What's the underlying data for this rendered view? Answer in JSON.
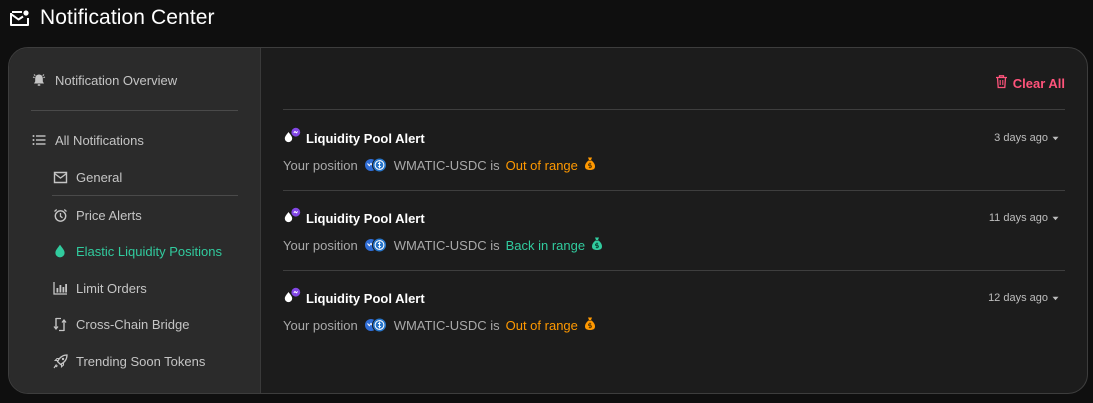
{
  "header": {
    "title": "Notification Center",
    "icon": "mail-bell-icon"
  },
  "sidebar": {
    "overview": {
      "label": "Notification Overview",
      "icon": "bell-icon"
    },
    "all": {
      "label": "All Notifications",
      "icon": "list-icon"
    },
    "items": [
      {
        "label": "General",
        "icon": "mail-icon"
      },
      {
        "label": "Price Alerts",
        "icon": "alarm-clock-icon"
      },
      {
        "label": "Elastic Liquidity Positions",
        "icon": "droplet-icon",
        "active": true
      },
      {
        "label": "Limit Orders",
        "icon": "bar-chart-icon"
      },
      {
        "label": "Cross-Chain Bridge",
        "icon": "bridge-icon"
      },
      {
        "label": "Trending Soon Tokens",
        "icon": "rocket-icon"
      }
    ]
  },
  "main": {
    "clear_all": "Clear All",
    "notifications": [
      {
        "title": "Liquidity Pool Alert",
        "time": "3 days ago",
        "prefix": "Your position",
        "pair": "WMATIC-USDC is",
        "status": "Out of range",
        "status_type": "out"
      },
      {
        "title": "Liquidity Pool Alert",
        "time": "11 days ago",
        "prefix": "Your position",
        "pair": "WMATIC-USDC is",
        "status": "Back in range",
        "status_type": "in"
      },
      {
        "title": "Liquidity Pool Alert",
        "time": "12 days ago",
        "prefix": "Your position",
        "pair": "WMATIC-USDC is",
        "status": "Out of range",
        "status_type": "out"
      }
    ]
  },
  "colors": {
    "accent": "#31cb9e",
    "danger": "#ff537b",
    "warning": "#ff9901",
    "matic": "#8247e5",
    "usdc": "#2775ca"
  }
}
